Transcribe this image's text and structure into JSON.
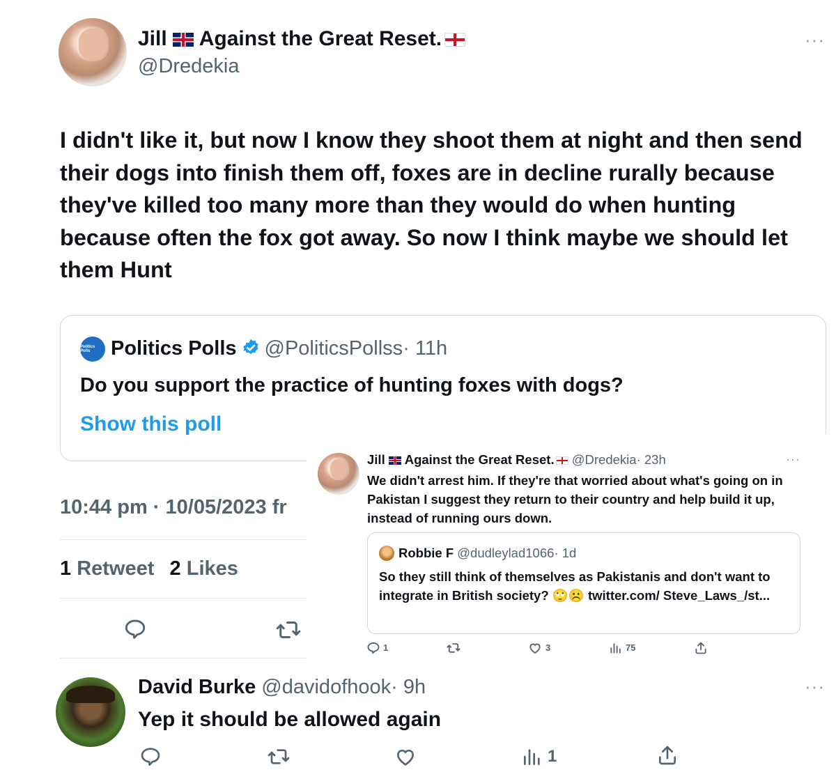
{
  "main_tweet": {
    "author_name": "Jill",
    "author_name_rest": "Against the Great Reset.",
    "handle": "@Dredekia",
    "text": "I didn't like it, but now I know they shoot them at night and then send their dogs into finish them off, foxes are in decline rurally because they've killed too many more than they would do when hunting because often the fox got away. So now I think maybe we should let them Hunt",
    "timestamp": "10:44 pm · 10/05/2023 fr",
    "retweet_count": "1",
    "retweet_label": "Retweet",
    "likes_count": "2",
    "likes_label": "Likes"
  },
  "quoted_poll": {
    "avatar_text": "Politics Polls",
    "author_name": "Politics Polls",
    "handle": "@PoliticsPollss",
    "time": "· 11h",
    "text": "Do you support the practice of hunting foxes with dogs?",
    "link": "Show this poll"
  },
  "overlay_tweet": {
    "author_name": "Jill",
    "author_name_rest": "Against the Great Reset.",
    "handle": "@Dredekia",
    "time": "· 23h",
    "text": "We didn't arrest him. If they're that worried about what's going on in Pakistan I suggest they return to their country and help build it up, instead of running ours down.",
    "quote": {
      "author_name": "Robbie F",
      "handle": "@dudleylad1066",
      "time": "· 1d",
      "text": "So they still think of themselves as Pakistanis and don't want to integrate in British society? 🙄☹️ twitter.com/ Steve_Laws_/st..."
    },
    "replies": "1",
    "likes": "3",
    "views": "75"
  },
  "reply_tweet": {
    "author_name": "David Burke",
    "handle": "@davidofhook",
    "time": "· 9h",
    "text": "Yep it should be allowed again",
    "views": "1"
  },
  "colors": {
    "link_blue": "#1d9bf0",
    "verified_blue": "#1d9bf0",
    "text": "#0f1419",
    "muted": "#536471"
  },
  "icons": [
    "more-icon",
    "reply-icon",
    "retweet-icon",
    "like-icon",
    "views-icon",
    "share-icon",
    "verified-badge-icon",
    "flag-uk-icon",
    "flag-england-icon"
  ]
}
